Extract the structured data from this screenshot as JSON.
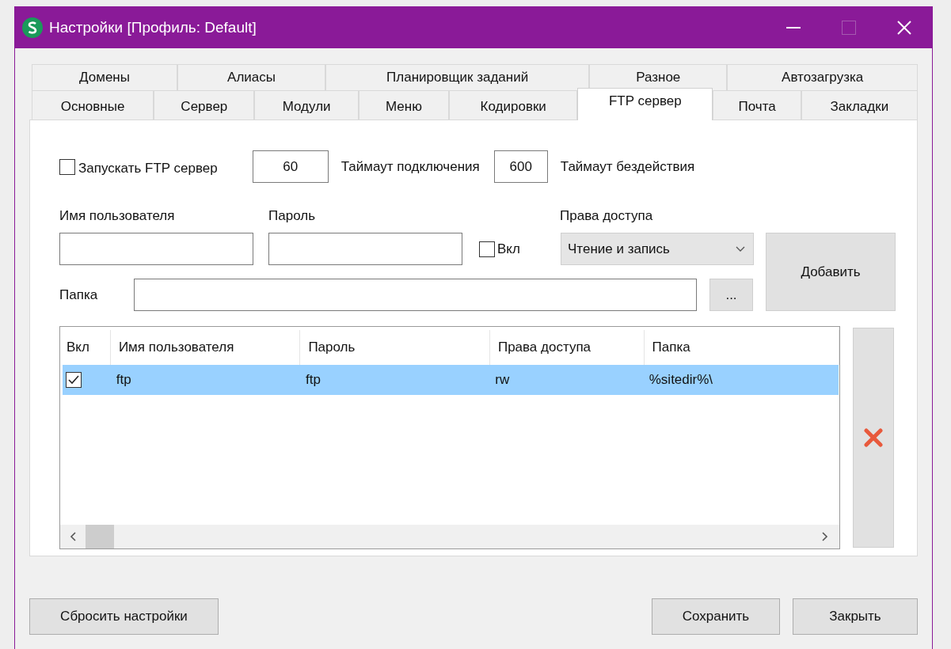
{
  "window": {
    "title": "Настройки [Профиль: Default]"
  },
  "tabs": [
    [
      {
        "label": "Домены",
        "selected": false
      },
      {
        "label": "Алиасы",
        "selected": false
      },
      {
        "label": "Планировщик заданий",
        "selected": false
      },
      {
        "label": "Разное",
        "selected": false
      },
      {
        "label": "Автозагрузка",
        "selected": false
      }
    ],
    [
      {
        "label": "Основные",
        "selected": false
      },
      {
        "label": "Сервер",
        "selected": false
      },
      {
        "label": "Модули",
        "selected": false
      },
      {
        "label": "Меню",
        "selected": false
      },
      {
        "label": "Кодировки",
        "selected": false
      },
      {
        "label": "FTP сервер",
        "selected": true
      },
      {
        "label": "Почта",
        "selected": false
      },
      {
        "label": "Закладки",
        "selected": false
      }
    ]
  ],
  "ftp": {
    "start_server": {
      "label": "Запускать FTP сервер",
      "checked": false
    },
    "connect_timeout": {
      "value": "60",
      "label": "Таймаут подключения"
    },
    "idle_timeout": {
      "value": "600",
      "label": "Таймаут бездействия"
    },
    "username": {
      "label": "Имя пользователя"
    },
    "password": {
      "label": "Пароль"
    },
    "enabled": {
      "label": "Вкл",
      "checked": false
    },
    "access": {
      "label": "Права доступа",
      "value": "Чтение и запись"
    },
    "add_button": "Добавить",
    "folder": {
      "label": "Папка"
    },
    "browse_button": "...",
    "table": {
      "columns": [
        "Вкл",
        "Имя пользователя",
        "Пароль",
        "Права доступа",
        "Папка"
      ],
      "rows": [
        {
          "selected": true,
          "cells": [
            {
              "kind": "checkbox",
              "checked": true
            },
            {
              "kind": "text",
              "text": "ftp"
            },
            {
              "kind": "text",
              "text": "ftp"
            },
            {
              "kind": "text",
              "text": "rw"
            },
            {
              "kind": "text",
              "text": "%sitedir%\\"
            }
          ]
        }
      ]
    }
  },
  "buttons": {
    "reset": "Сбросить настройки",
    "save": "Сохранить",
    "close": "Закрыть"
  }
}
